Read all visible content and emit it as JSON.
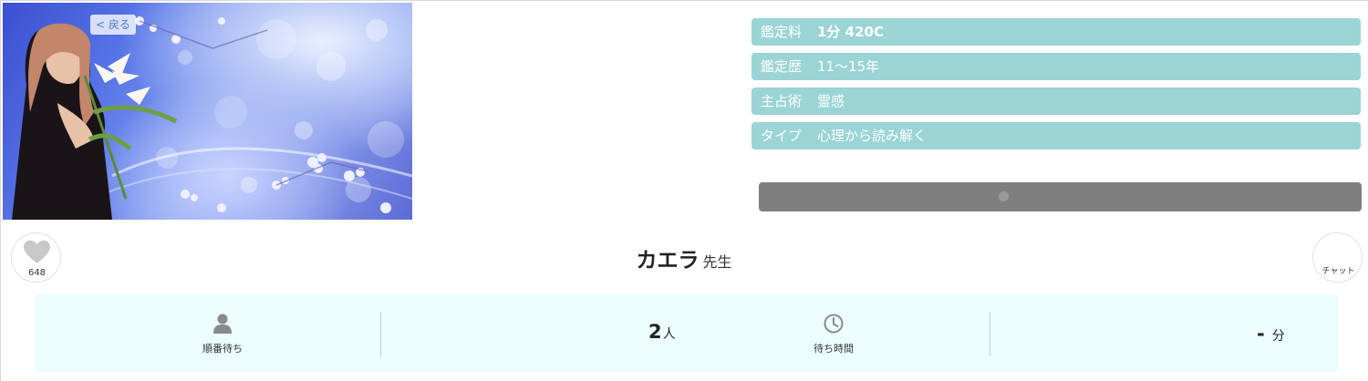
{
  "hero": {
    "back_label": "< 戻る"
  },
  "info": {
    "fee_label": "鑑定料",
    "fee_value": "1分 420C",
    "history_label": "鑑定歴",
    "history_value": "11〜15年",
    "method_label": "主占術",
    "method_value": "霊感",
    "type_label": "タイプ",
    "type_value": "心理から読み解く"
  },
  "favorite": {
    "icon": "heart-icon",
    "count": "648"
  },
  "profile": {
    "name": "カエラ",
    "title": "先生"
  },
  "chat": {
    "label": "チャット"
  },
  "status": {
    "queue_icon": "person-icon",
    "queue_label": "順番待ち",
    "queue_count": "2",
    "queue_unit": "人",
    "wait_icon": "clock-icon",
    "wait_label": "待ち時間",
    "wait_value": "-",
    "wait_unit": "分"
  },
  "colors": {
    "info_row_bg": "#9ad4d4",
    "status_bg": "#ecfefe",
    "gray_button": "#7f7f7f"
  }
}
